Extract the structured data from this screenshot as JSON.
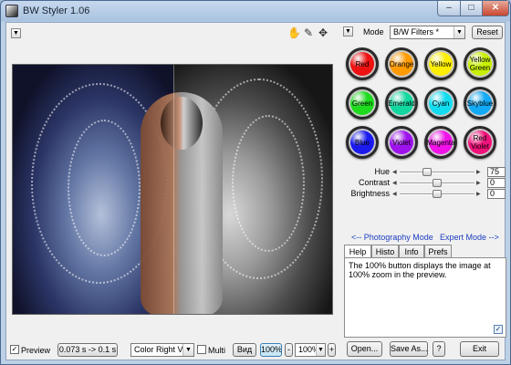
{
  "window": {
    "title": "BW Styler 1.06",
    "controls": {
      "minimize": "–",
      "maximize": "□",
      "close": "✕"
    }
  },
  "toolbar": {
    "hand_tool_icon": "hand-icon",
    "picker_tool_icon": "eyedropper-icon",
    "move_tool_icon": "move-arrows-icon"
  },
  "mode": {
    "label": "Mode",
    "value": "B/W Filters *",
    "reset_label": "Reset"
  },
  "filters": [
    {
      "label": "Red",
      "color": "#ee1111",
      "text_color": "#000000"
    },
    {
      "label": "Orange",
      "color": "#ff9a00",
      "text_color": "#000000"
    },
    {
      "label": "Yellow",
      "color": "#ffee00",
      "text_color": "#000000"
    },
    {
      "label": "Yellow Green",
      "color": "#c6f000",
      "text_color": "#000000"
    },
    {
      "label": "Green",
      "color": "#1ddb1d",
      "text_color": "#000000"
    },
    {
      "label": "Emerald",
      "color": "#12d79f",
      "text_color": "#000000"
    },
    {
      "label": "Cyan",
      "color": "#12dcf0",
      "text_color": "#000000"
    },
    {
      "label": "Skyblue",
      "color": "#12a9f5",
      "text_color": "#000000"
    },
    {
      "label": "Blue",
      "color": "#1a1aee",
      "text_color": "#000000"
    },
    {
      "label": "Violet",
      "color": "#9e12ee",
      "text_color": "#000000"
    },
    {
      "label": "Magenta",
      "color": "#f012e8",
      "text_color": "#000000"
    },
    {
      "label": "Red Violet",
      "color": "#f0127a",
      "text_color": "#000000"
    }
  ],
  "adjustments": [
    {
      "label": "Hue",
      "value": "75",
      "level": 0.37
    },
    {
      "label": "Contrast",
      "value": "0",
      "level": 0.5
    },
    {
      "label": "Brightness",
      "value": "0",
      "level": 0.5
    }
  ],
  "links": {
    "photography_mode": "<-- Photography Mode",
    "expert_mode": "Expert Mode -->"
  },
  "tabs": [
    {
      "label": "Help",
      "selected": true
    },
    {
      "label": "Histo",
      "selected": false
    },
    {
      "label": "Info",
      "selected": false
    },
    {
      "label": "Prefs",
      "selected": false
    }
  ],
  "help_text": "The 100% button displays the image at 100% zoom in the preview.",
  "bottom": {
    "preview_label": "Preview",
    "preview_checked": true,
    "timing": "0.073 s -> 0.1 s",
    "view_mode": "Color Right View",
    "multi_label": "Multi",
    "multi_checked": false,
    "view_button": "Вид",
    "zoom_100_button": "100%",
    "zoom_minus": "-",
    "zoom_value": "100%",
    "zoom_plus": "+",
    "open_button": "Open...",
    "save_button": "Save As...",
    "help_button": "?",
    "exit_button": "Exit"
  }
}
